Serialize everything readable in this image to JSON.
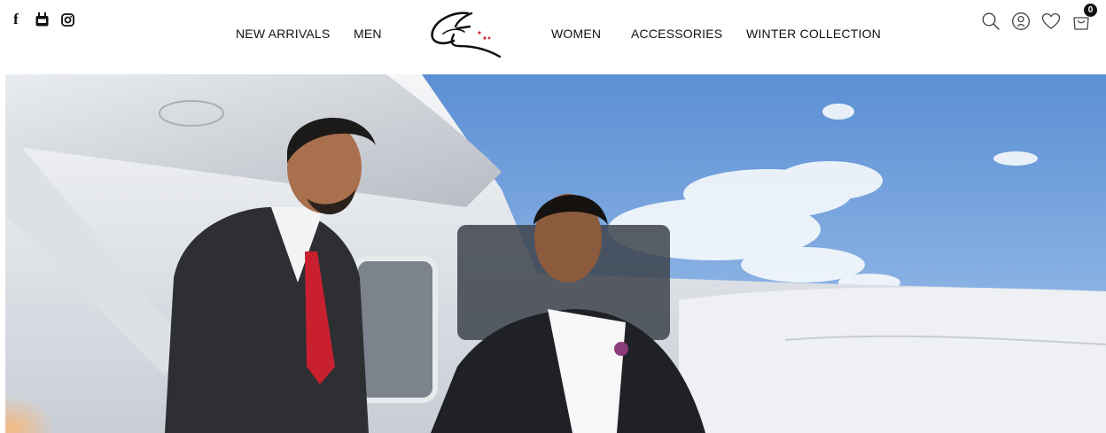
{
  "social": {
    "facebook_label": "f",
    "facebook_icon": "facebook-icon",
    "youtube_icon": "youtube-icon",
    "instagram_icon": "instagram-icon"
  },
  "nav": {
    "left": [
      "NEW ARRIVALS",
      "MEN"
    ],
    "right": [
      "WOMEN",
      "ACCESSORIES",
      "WINTER COLLECTION"
    ]
  },
  "logo": {
    "icon": "brand-logo-icon"
  },
  "header_icons": {
    "search_icon": "search-icon",
    "account_icon": "user-account-icon",
    "wishlist_icon": "heart-icon",
    "cart_icon": "shopping-bag-icon",
    "cart_count": "0"
  },
  "hero": {
    "alt_subject": "two men in business suits standing beside a white airplane under a blue sky",
    "sky_color": "#6f9fd8"
  }
}
